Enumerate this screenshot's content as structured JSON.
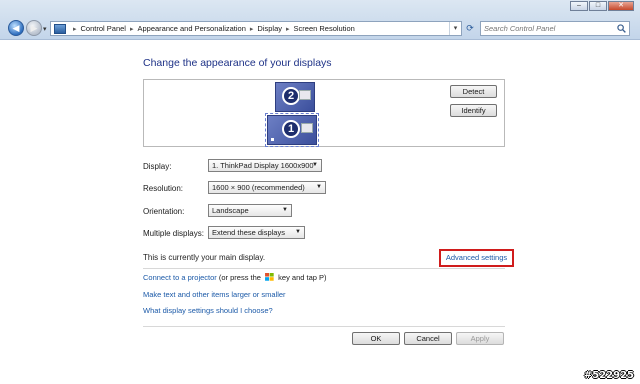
{
  "window": {
    "controls": {
      "minimize": "–",
      "maximize": "□",
      "close": "✕"
    }
  },
  "nav": {
    "back_icon": "arrow-left-icon",
    "forward_icon": "arrow-right-icon",
    "back_glyph": "◀",
    "forward_glyph": "▶",
    "history_glyph": "▾",
    "breadcrumbs": [
      "Control Panel",
      "Appearance and Personalization",
      "Display",
      "Screen Resolution"
    ],
    "breadcrumb_separator": "▸",
    "address_dropdown_glyph": "▾",
    "refresh_glyph": "⟳",
    "search_placeholder": "Search Control Panel"
  },
  "page": {
    "title": "Change the appearance of your displays",
    "monitors": [
      {
        "number": "2"
      },
      {
        "number": "1"
      }
    ],
    "detect_label": "Detect",
    "identify_label": "Identify",
    "fields": {
      "display": {
        "label": "Display:",
        "value": "1. ThinkPad Display 1600x900"
      },
      "resolution": {
        "label": "Resolution:",
        "value": "1600 × 900 (recommended)"
      },
      "orientation": {
        "label": "Orientation:",
        "value": "Landscape"
      },
      "multiple": {
        "label": "Multiple displays:",
        "value": "Extend these displays"
      }
    },
    "dropdown_arrow": "▼",
    "main_display_text": "This is currently your main display.",
    "advanced_settings": "Advanced settings",
    "projector_link": "Connect to a projector",
    "projector_rest_1": " (or press the ",
    "projector_rest_2": " key and tap P)",
    "text_size_link": "Make text and other items larger or smaller",
    "which_settings_link": "What display settings should I choose?",
    "ok_label": "OK",
    "cancel_label": "Cancel",
    "apply_label": "Apply"
  },
  "watermark": "#522925",
  "colors": {
    "link": "#1c5aa8",
    "title": "#1e3287",
    "highlight_box": "#d01c1c"
  }
}
